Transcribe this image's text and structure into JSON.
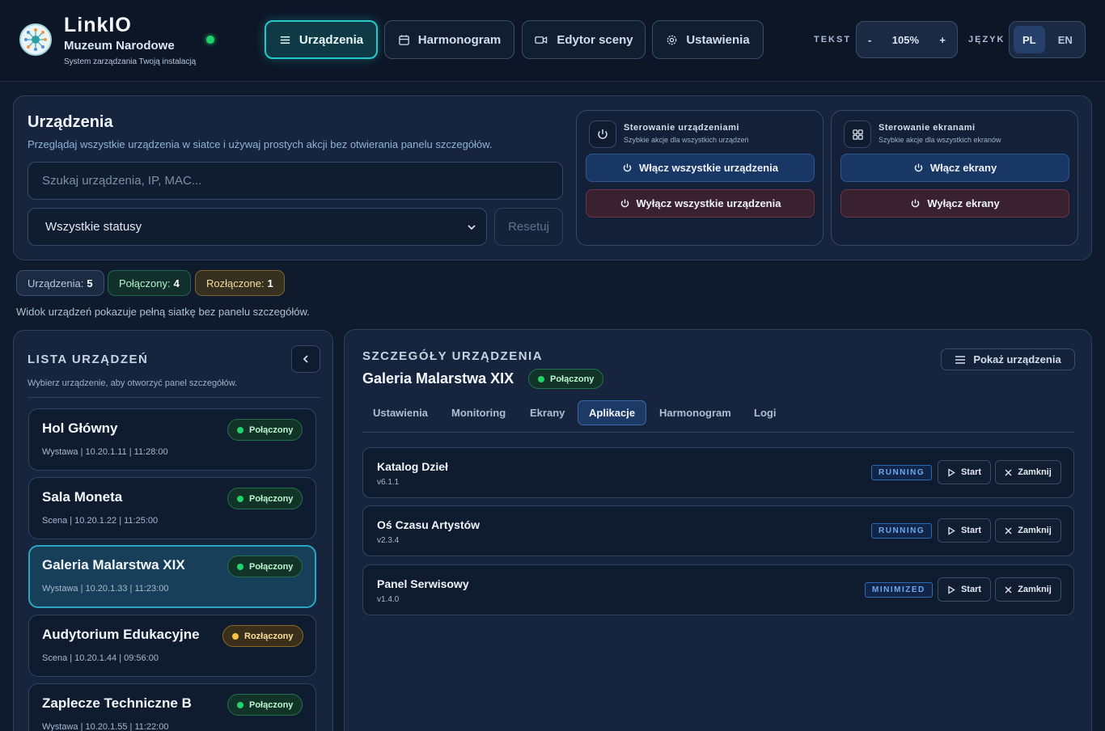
{
  "brand": {
    "name": "LinkIO",
    "org": "Muzeum Narodowe",
    "tagline": "System zarządzania Twoją instalacją"
  },
  "nav": [
    {
      "label": "Urządzenia",
      "icon": "menu-icon",
      "active": true
    },
    {
      "label": "Harmonogram",
      "icon": "calendar-icon",
      "active": false
    },
    {
      "label": "Edytor sceny",
      "icon": "video-icon",
      "active": false
    },
    {
      "label": "Ustawienia",
      "icon": "gear-icon",
      "active": false
    }
  ],
  "text_control": {
    "label": "TEKST",
    "minus": "-",
    "value": "105%",
    "plus": "+"
  },
  "language": {
    "label": "JĘZYK",
    "options": [
      "PL",
      "EN"
    ],
    "selected": "PL"
  },
  "devices_panel": {
    "title": "Urządzenia",
    "description": "Przeglądaj wszystkie urządzenia w siatce i używaj prostych akcji bez otwierania panelu szczegółów.",
    "search_placeholder": "Szukaj urządzenia, IP, MAC...",
    "status_filter": "Wszystkie statusy",
    "reset_label": "Resetuj"
  },
  "device_control": {
    "title": "Sterowanie urządzeniami",
    "subtitle": "Szybkie akcje dla wszystkich urządzeń",
    "on_label": "Włącz wszystkie urządzenia",
    "off_label": "Wyłącz wszystkie urządzenia"
  },
  "screen_control": {
    "title": "Sterowanie ekranami",
    "subtitle": "Szybkie akcje dla wszystkich ekranów",
    "on_label": "Włącz ekrany",
    "off_label": "Wyłącz ekrany"
  },
  "counts": {
    "all_label": "Urządzenia:",
    "all_value": "5",
    "connected_label": "Połączony:",
    "connected_value": "4",
    "disconnected_label": "Rozłączone:",
    "disconnected_value": "1"
  },
  "view_info": "Widok urządzeń pokazuje pełną siatkę bez panelu szczegółów.",
  "device_list": {
    "title": "LISTA URZĄDZEŃ",
    "subtitle": "Wybierz urządzenie, aby otworzyć panel szczegółów.",
    "items": [
      {
        "name": "Hol Główny",
        "meta": "Wystawa | 10.20.1.11 | 11:28:00",
        "status": "Połączony",
        "state": "ok",
        "selected": false
      },
      {
        "name": "Sala Moneta",
        "meta": "Scena | 10.20.1.22 | 11:25:00",
        "status": "Połączony",
        "state": "ok",
        "selected": false
      },
      {
        "name": "Galeria Malarstwa XIX",
        "meta": "Wystawa | 10.20.1.33 | 11:23:00",
        "status": "Połączony",
        "state": "ok",
        "selected": true
      },
      {
        "name": "Audytorium Edukacyjne",
        "meta": "Scena | 10.20.1.44 | 09:56:00",
        "status": "Rozłączony",
        "state": "warn",
        "selected": false
      },
      {
        "name": "Zaplecze Techniczne B",
        "meta": "Wystawa | 10.20.1.55 | 11:22:00",
        "status": "Połączony",
        "state": "ok",
        "selected": false
      }
    ]
  },
  "details": {
    "title": "SZCZEGÓŁY URZĄDZENIA",
    "device_name": "Galeria Malarstwa XIX",
    "status": "Połączony",
    "show_devices_label": "Pokaż urządzenia",
    "tabs": [
      "Ustawienia",
      "Monitoring",
      "Ekrany",
      "Aplikacje",
      "Harmonogram",
      "Logi"
    ],
    "active_tab": "Aplikacje",
    "apps": [
      {
        "name": "Katalog Dzieł",
        "version": "v6.1.1",
        "state": "RUNNING",
        "start_label": "Start",
        "close_label": "Zamknij"
      },
      {
        "name": "Oś Czasu Artystów",
        "version": "v2.3.4",
        "state": "RUNNING",
        "start_label": "Start",
        "close_label": "Zamknij"
      },
      {
        "name": "Panel Serwisowy",
        "version": "v1.4.0",
        "state": "MINIMIZED",
        "start_label": "Start",
        "close_label": "Zamknij"
      }
    ]
  },
  "colors": {
    "accent": "#26c6c9",
    "connected": "#21d36b",
    "disconnected": "#f5c542",
    "state_badge": "#6ea8ec"
  }
}
